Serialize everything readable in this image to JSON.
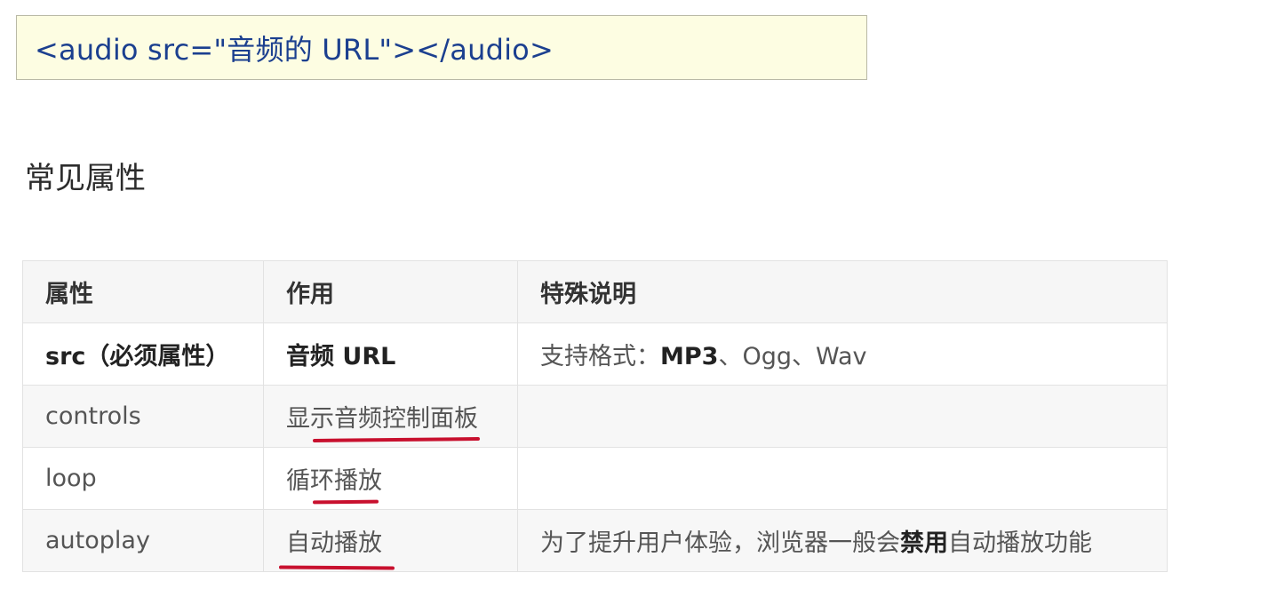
{
  "code_box": {
    "text": "<audio src=\"音频的 URL\"></audio>"
  },
  "section": {
    "heading": "常见属性"
  },
  "table": {
    "headers": [
      "属性",
      "作用",
      "特殊说明"
    ],
    "rows": [
      {
        "attribute": "src（必须属性）",
        "purpose": "音频 URL",
        "note_prefix": "支持格式：",
        "note_bold": "MP3",
        "note_suffix": "、Ogg、Wav"
      },
      {
        "attribute": "controls",
        "purpose": "显示音频控制面板",
        "note": ""
      },
      {
        "attribute": "loop",
        "purpose": "循环播放",
        "note": ""
      },
      {
        "attribute": "autoplay",
        "purpose": "自动播放",
        "note_prefix": "为了提升用户体验，浏览器一般会",
        "note_bold": "禁用",
        "note_suffix": "自动播放功能"
      }
    ]
  },
  "annotations": {
    "underline_color": "#c8102e"
  }
}
